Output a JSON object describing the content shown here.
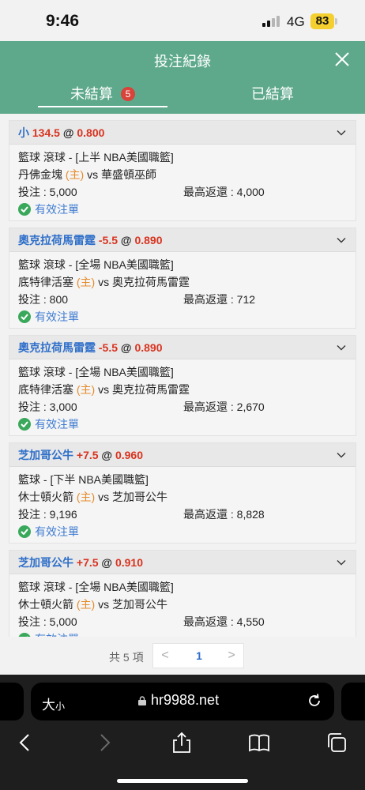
{
  "status": {
    "time": "9:46",
    "network": "4G",
    "battery": "83"
  },
  "header": {
    "title": "投注紀錄"
  },
  "tabs": {
    "open_label": "未結算",
    "open_count": "5",
    "settled_label": "已結算"
  },
  "bets": [
    {
      "selection": "小",
      "line": "134.5",
      "at": "@",
      "odds": "0.800",
      "sport_line": "籃球 滾球 - [上半 NBA美國職籃]",
      "home_team": "丹佛金塊",
      "home_tag": "(主)",
      "vs": "vs",
      "away_team": "華盛頓巫師",
      "stake_label": "投注 : 5,000",
      "max_return_label": "最高返還 : 4,000",
      "status": "有效注單"
    },
    {
      "selection": "奧克拉荷馬雷霆",
      "line": "-5.5",
      "at": "@",
      "odds": "0.890",
      "sport_line": "籃球 滾球 - [全場 NBA美國職籃]",
      "home_team": "底特律活塞",
      "home_tag": "(主)",
      "vs": "vs",
      "away_team": "奧克拉荷馬雷霆",
      "stake_label": "投注 : 800",
      "max_return_label": "最高返還 : 712",
      "status": "有效注單"
    },
    {
      "selection": "奧克拉荷馬雷霆",
      "line": "-5.5",
      "at": "@",
      "odds": "0.890",
      "sport_line": "籃球 滾球 - [全場 NBA美國職籃]",
      "home_team": "底特律活塞",
      "home_tag": "(主)",
      "vs": "vs",
      "away_team": "奧克拉荷馬雷霆",
      "stake_label": "投注 : 3,000",
      "max_return_label": "最高返還 : 2,670",
      "status": "有效注單"
    },
    {
      "selection": "芝加哥公牛",
      "line": "+7.5",
      "at": "@",
      "odds": "0.960",
      "sport_line": "籃球 - [下半 NBA美國職籃]",
      "home_team": "休士頓火箭",
      "home_tag": "(主)",
      "vs": "vs",
      "away_team": "芝加哥公牛",
      "stake_label": "投注 : 9,196",
      "max_return_label": "最高返還 : 8,828",
      "status": "有效注單"
    },
    {
      "selection": "芝加哥公牛",
      "line": "+7.5",
      "at": "@",
      "odds": "0.910",
      "sport_line": "籃球 滾球 - [全場 NBA美國職籃]",
      "home_team": "休士頓火箭",
      "home_tag": "(主)",
      "vs": "vs",
      "away_team": "芝加哥公牛",
      "stake_label": "投注 : 5,000",
      "max_return_label": "最高返還 : 4,550",
      "status": "有效注單"
    }
  ],
  "pagination": {
    "total_label": "共 5 項",
    "prev": "<",
    "current": "1",
    "next": ">"
  },
  "browser": {
    "text_size_big": "大",
    "text_size_small": "小",
    "url": "hr9988.net"
  },
  "colors": {
    "header_green": "#5ea98c",
    "selection_blue": "#2f6fc9",
    "odds_red": "#d9331f",
    "home_orange": "#e58b2a",
    "badge_red": "#d8433a",
    "valid_green": "#3aa85b"
  },
  "icons": [
    "close-icon",
    "chevron-down-icon",
    "check-circle-icon",
    "lock-icon",
    "reload-icon",
    "back-icon",
    "forward-icon",
    "share-icon",
    "bookmarks-icon",
    "tabs-icon"
  ]
}
